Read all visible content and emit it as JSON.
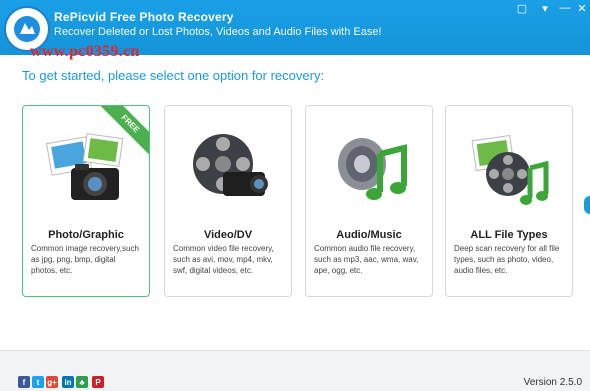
{
  "header": {
    "title": "RePicvid Free Photo Recovery",
    "subtitle": "Recover Deleted or Lost Photos, Videos and Audio Files with Ease!",
    "watermark": "www.pc0359.cn",
    "controls": {
      "feedback": "▢",
      "dropdown": "▾",
      "minimize": "—",
      "close": "✕"
    }
  },
  "prompt": "To get started, please select one option for recovery:",
  "cards": [
    {
      "title": "Photo/Graphic",
      "desc": "Common image recovery,such as jpg, png, bmp, digital photos, etc.",
      "ribbon": "FREE"
    },
    {
      "title": "Video/DV",
      "desc": "Common video file recovery, such as avi, mov, mp4, mkv, swf, digital videos, etc."
    },
    {
      "title": "Audio/Music",
      "desc": "Common audio file recovery, such as mp3, aac, wma, wav, ape, ogg, etc."
    },
    {
      "title": "ALL File Types",
      "desc": "Deep scan recovery for all file types, such as photo, video, audio files, etc."
    }
  ],
  "footer": {
    "social": [
      {
        "label": "f",
        "color": "#3b5998"
      },
      {
        "label": "t",
        "color": "#1da1f2"
      },
      {
        "label": "g+",
        "color": "#dd4b39"
      },
      {
        "label": "in",
        "color": "#0077b5"
      },
      {
        "label": "♣",
        "color": "#2e9e4f"
      },
      {
        "label": "P",
        "color": "#cb2027"
      }
    ],
    "version": "Version 2.5.0"
  },
  "colors": {
    "accent": "#1a9ad9",
    "free_ribbon": "#4caf50"
  }
}
